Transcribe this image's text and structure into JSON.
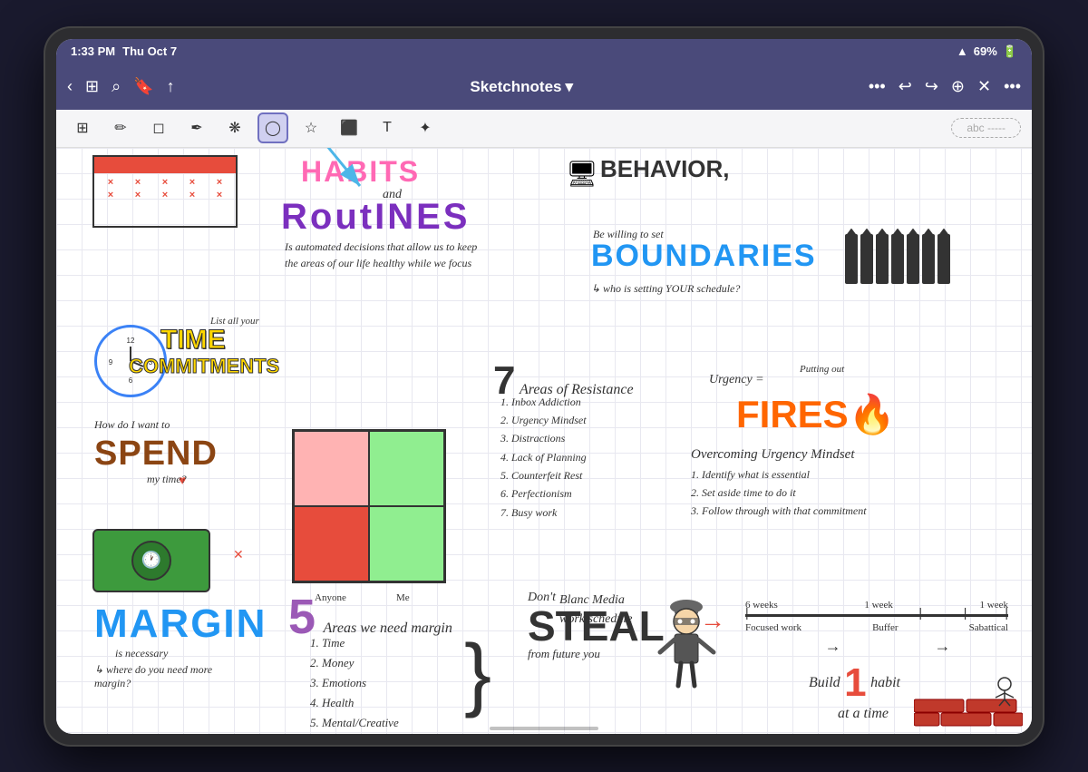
{
  "device": {
    "status_bar": {
      "time": "1:33 PM",
      "date": "Thu Oct 7",
      "wifi": "WiFi",
      "battery": "69%"
    },
    "nav_bar": {
      "title": "Sketchnotes",
      "dropdown_indicator": "▾"
    }
  },
  "toolbar": {
    "tools": [
      {
        "name": "image-tool",
        "icon": "⊞",
        "active": false
      },
      {
        "name": "pencil-tool",
        "icon": "✏",
        "active": false
      },
      {
        "name": "eraser-tool",
        "icon": "⬜",
        "active": false
      },
      {
        "name": "marker-tool",
        "icon": "✒",
        "active": false
      },
      {
        "name": "color-tool",
        "icon": "❋",
        "active": false
      },
      {
        "name": "lasso-tool",
        "icon": "◯",
        "active": true
      },
      {
        "name": "star-tool",
        "icon": "☆",
        "active": false
      },
      {
        "name": "photo-tool",
        "icon": "⬛",
        "active": false
      },
      {
        "name": "text-tool",
        "icon": "T",
        "active": false
      },
      {
        "name": "stylus-tool",
        "icon": "✦",
        "active": false
      }
    ],
    "auto_label": "abc -----"
  },
  "content": {
    "habits_title": "HABITS",
    "and_text": "and",
    "routines_title": "RoutINES",
    "routines_desc": "Is automated decisions that allow us to keep the areas of our life healthy while we focus",
    "behavior_title": "BEHAVIOR,",
    "be_willing": "Be willing to set",
    "boundaries_title": "BOUNDARIES",
    "who_setting": "↳ who is setting YOUR schedule?",
    "list_all": "List all your",
    "time_title": "TIME",
    "commitments_title": "COMMITMENTS",
    "seven_areas": {
      "num": "7",
      "label": "Areas of Resistance",
      "items": [
        "1. Inbox Addiction",
        "2. Urgency Mindset",
        "3. Distractions",
        "4. Lack of Planning",
        "5. Counterfeit Rest",
        "6. Perfectionism",
        "7. Busy work"
      ]
    },
    "urgency": "Urgency =",
    "putting_out": "Putting out",
    "fires_title": "FIRES🔥",
    "overcoming": {
      "title": "Overcoming Urgency Mindset",
      "items": [
        "1. Identify what is essential",
        "2. Set aside time to do it",
        "3. Follow through with that commitment"
      ]
    },
    "how_do": "How do I want to",
    "spend_title": "SPEND",
    "my_time": "my time?",
    "five_areas": {
      "num": "5",
      "label": "Areas we need margin",
      "items": [
        "1. Time",
        "2. Money",
        "3. Emotions",
        "4. Health",
        "5. Mental/Creative"
      ]
    },
    "margin_title": "MARGIN",
    "margin_sub": "is necessary",
    "where_margin": "↳ where do you need more margin?",
    "dont_steal": "Don't",
    "steal_title": "STEAL",
    "from_future": "from future you",
    "blanc_schedule": "Blanc Media\nwork schedule",
    "timeline": {
      "labels": [
        "6 weeks",
        "1 week",
        "1 week"
      ],
      "rows": [
        "Focused work",
        "Buffer",
        "Sabattical"
      ]
    },
    "build_habit": "Build",
    "habit_num": "1",
    "habit_rest": "habit\nat a time"
  }
}
